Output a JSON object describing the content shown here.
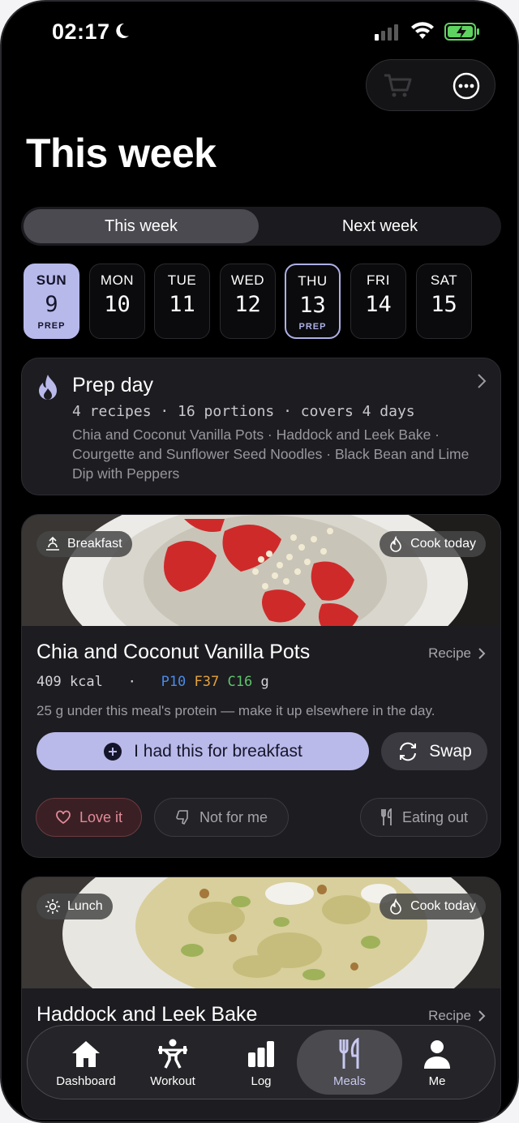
{
  "status": {
    "time": "02:17"
  },
  "page": {
    "title": "This week"
  },
  "segment": {
    "active": "This week",
    "inactive": "Next week"
  },
  "days": [
    {
      "name": "SUN",
      "num": "9",
      "tag": "PREP"
    },
    {
      "name": "MON",
      "num": "10",
      "tag": ""
    },
    {
      "name": "TUE",
      "num": "11",
      "tag": ""
    },
    {
      "name": "WED",
      "num": "12",
      "tag": ""
    },
    {
      "name": "THU",
      "num": "13",
      "tag": "PREP"
    },
    {
      "name": "FRI",
      "num": "14",
      "tag": ""
    },
    {
      "name": "SAT",
      "num": "15",
      "tag": ""
    }
  ],
  "prep": {
    "title": "Prep day",
    "stats": "4 recipes · 16 portions · covers 4 days",
    "recipes": "Chia and Coconut Vanilla Pots · Haddock and Leek Bake · Courgette and Sunflower Seed Noodles · Black Bean and Lime Dip with Peppers"
  },
  "meals": [
    {
      "slot": "Breakfast",
      "status": "Cook today",
      "name": "Chia and Coconut Vanilla Pots",
      "recipe_label": "Recipe",
      "kcal": "409 kcal",
      "sep": "·",
      "protein": "P10",
      "fat": "F37",
      "carbs": "C16",
      "unit": "g",
      "note": "25 g under this meal's protein — make it up elsewhere in the day.",
      "had_label": "I had this for breakfast",
      "swap_label": "Swap",
      "love_label": "Love it",
      "notforme_label": "Not for me",
      "eatingout_label": "Eating out"
    },
    {
      "slot": "Lunch",
      "status": "Cook today",
      "name": "Haddock and Leek Bake",
      "recipe_label": "Recipe"
    }
  ],
  "tabs": [
    {
      "label": "Dashboard",
      "icon": "house-icon"
    },
    {
      "label": "Workout",
      "icon": "weightlifter-icon"
    },
    {
      "label": "Log",
      "icon": "bar-chart-icon"
    },
    {
      "label": "Meals",
      "icon": "fork-knife-icon"
    },
    {
      "label": "Me",
      "icon": "person-icon"
    }
  ],
  "colors": {
    "accent": "#b9b9ea",
    "protein": "#4b8ae8",
    "fat": "#e5a23a",
    "carbs": "#5fc36a",
    "love": "#e28a98",
    "battery": "#5fd35f"
  }
}
